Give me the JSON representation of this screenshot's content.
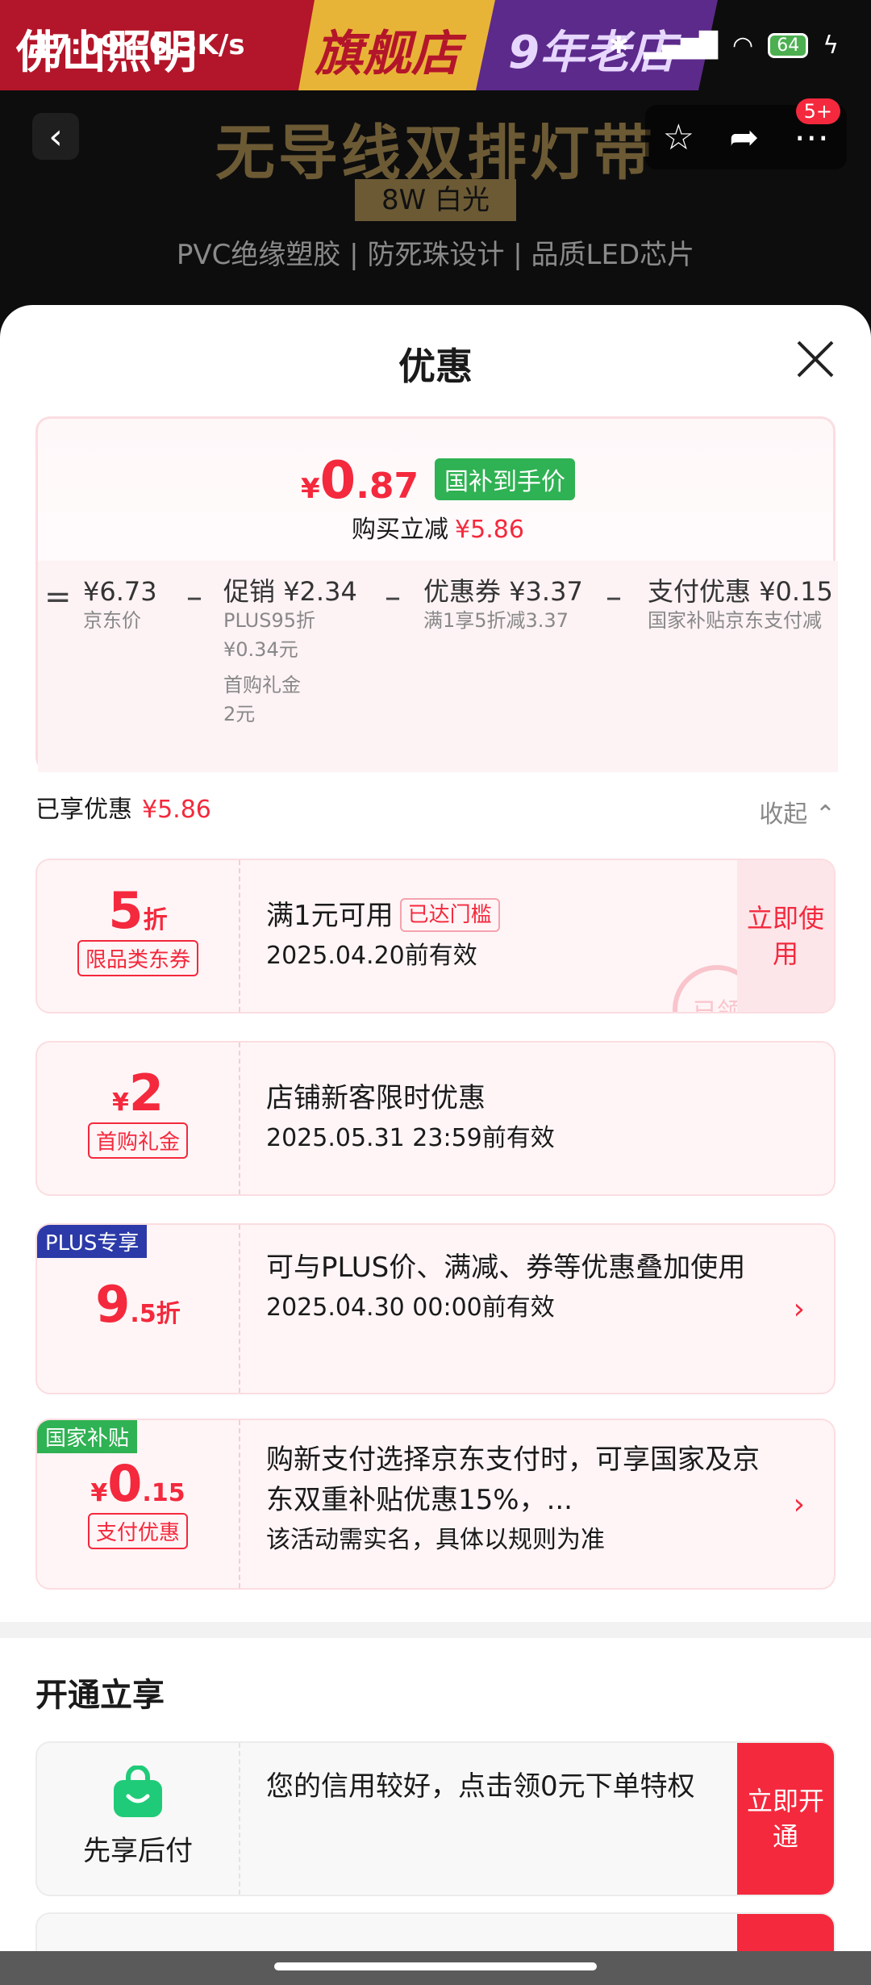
{
  "status": {
    "time": "17:09 | 6.3K/s",
    "battery": "64"
  },
  "banner": {
    "brand": "佛山照明",
    "flagship": "旗舰店",
    "years": "9年老店"
  },
  "nav": {
    "badge": "5+"
  },
  "product": {
    "title": "无导线双排灯带",
    "spec": "8W 白光",
    "features": "PVC绝缘塑胶 | 防死珠设计 | 品质LED芯片"
  },
  "sheet": {
    "title": "优惠"
  },
  "price": {
    "currency": "¥",
    "int": "0",
    "dec": ".87",
    "tag": "国补到手价",
    "sub_label": "购买立减",
    "sub_value": "¥5.86",
    "breakdown": {
      "equals": "=",
      "jd": {
        "value": "¥6.73",
        "label": "京东价"
      },
      "promo": {
        "label": "促销",
        "value": "¥2.34",
        "detail1": "PLUS95折",
        "detail2": "¥0.34元",
        "detail3": "首购礼金",
        "detail4": "2元"
      },
      "coupon": {
        "label": "优惠券",
        "value": "¥3.37",
        "detail": "满1享5折减3.37"
      },
      "pay": {
        "label": "支付优惠",
        "value": "¥0.15",
        "detail": "国家补贴京东支付减"
      },
      "minus": "–"
    }
  },
  "enjoyed": {
    "label": "已享优惠",
    "value": "¥5.86",
    "collapse": "收起"
  },
  "coupons": [
    {
      "value": "5",
      "unit": "折",
      "chip": "限品类东券",
      "title": "满1元可用",
      "tag": "已达门槛",
      "date": "2025.04.20前有效",
      "button": "立即使用",
      "stamp": "已领"
    },
    {
      "currency": "¥",
      "value": "2",
      "chip": "首购礼金",
      "title": "店铺新客限时优惠",
      "date": "2025.05.31 23:59前有效"
    },
    {
      "corner": "PLUS专享",
      "value": "9",
      "dec": ".5",
      "unit": "折",
      "title": "可与PLUS价、满减、券等优惠叠加使用",
      "date": "2025.04.30 00:00前有效"
    },
    {
      "corner": "国家补贴",
      "currency": "¥",
      "value": "0",
      "dec": ".15",
      "chip": "支付优惠",
      "title": "购新支付选择京东支付时，可享国家及京东双重补贴优惠15%，...",
      "note": "该活动需实名，具体以规则为准"
    }
  ],
  "open_section": {
    "title": "开通立享",
    "card": {
      "name": "先享后付",
      "text": "您的信用较好，点击领0元下单特权",
      "button": "立即开通"
    }
  },
  "colors": {
    "accent": "#f4293d",
    "green": "#2fb253",
    "plus": "#2b3aa8"
  }
}
